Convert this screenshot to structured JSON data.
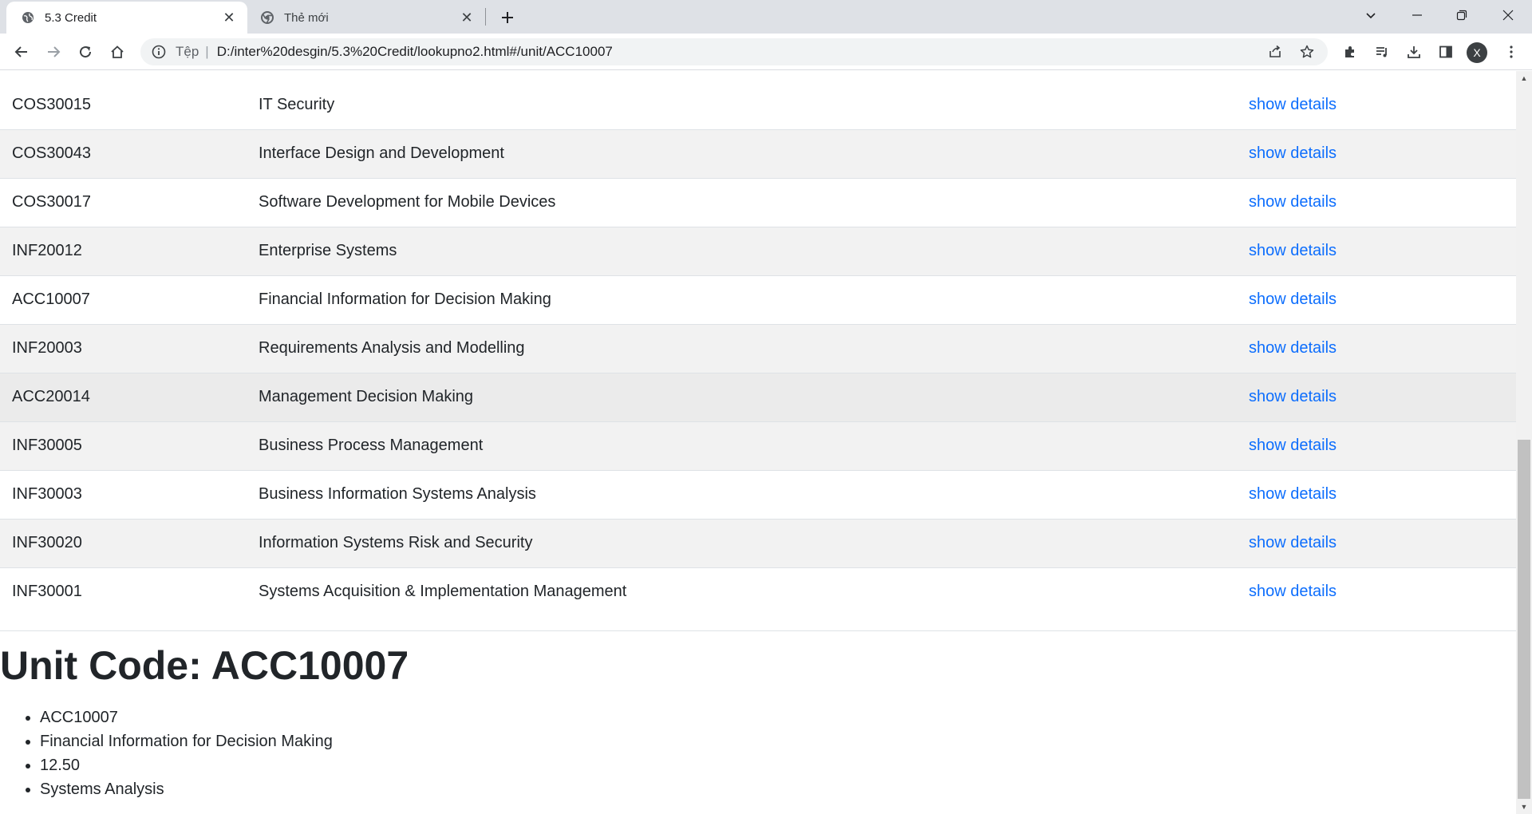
{
  "tabs": [
    {
      "title": "5.3 Credit",
      "icon": "globe-icon",
      "active": true
    },
    {
      "title": "Thẻ mới",
      "icon": "chrome-icon",
      "active": false
    }
  ],
  "address_bar": {
    "scheme_label": "Tệp",
    "url": "D:/inter%20desgin/5.3%20Credit/lookupno2.html#/unit/ACC10007"
  },
  "profile": {
    "initial": "X"
  },
  "units": {
    "action_label": "show details",
    "rows": [
      {
        "code": "COS30015",
        "name": "IT Security"
      },
      {
        "code": "COS30043",
        "name": "Interface Design and Development"
      },
      {
        "code": "COS30017",
        "name": "Software Development for Mobile Devices"
      },
      {
        "code": "INF20012",
        "name": "Enterprise Systems"
      },
      {
        "code": "ACC10007",
        "name": "Financial Information for Decision Making"
      },
      {
        "code": "INF20003",
        "name": "Requirements Analysis and Modelling"
      },
      {
        "code": "ACC20014",
        "name": "Management Decision Making"
      },
      {
        "code": "INF30005",
        "name": "Business Process Management"
      },
      {
        "code": "INF30003",
        "name": "Business Information Systems Analysis"
      },
      {
        "code": "INF30020",
        "name": "Information Systems Risk and Security"
      },
      {
        "code": "INF30001",
        "name": "Systems Acquisition & Implementation Management"
      }
    ]
  },
  "detail": {
    "heading": "Unit Code: ACC10007",
    "items": [
      "ACC10007",
      "Financial Information for Decision Making",
      "12.50",
      "Systems Analysis"
    ]
  },
  "colors": {
    "link": "#0d6efd",
    "stripe": "#f2f2f2",
    "text": "#212529"
  }
}
